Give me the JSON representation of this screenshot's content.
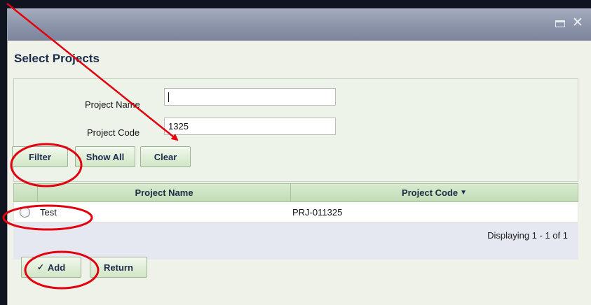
{
  "dialog": {
    "title": "Select Projects",
    "window_controls": {
      "maximize_icon": "maximize-icon",
      "close_icon": "close-icon",
      "close_glyph": "✕"
    }
  },
  "filter": {
    "project_name_label": "Project Name",
    "project_name_value": "",
    "project_code_label": "Project Code",
    "project_code_value": "1325",
    "buttons": {
      "filter": "Filter",
      "show_all": "Show All",
      "clear": "Clear"
    }
  },
  "grid": {
    "columns": [
      {
        "key": "name",
        "label": "Project Name"
      },
      {
        "key": "code",
        "label": "Project Code",
        "sort_glyph": "▼"
      }
    ],
    "rows": [
      {
        "name": "Test",
        "code": "PRJ-011325",
        "selected": false
      }
    ],
    "paging_text": "Displaying 1 - 1 of 1"
  },
  "actions": {
    "add": "Add",
    "add_icon_glyph": "✓",
    "return": "Return"
  },
  "colors": {
    "accent_green": "#d2e6c7",
    "title_text": "#1c2b4a",
    "annotation_red": "#e3000f"
  }
}
